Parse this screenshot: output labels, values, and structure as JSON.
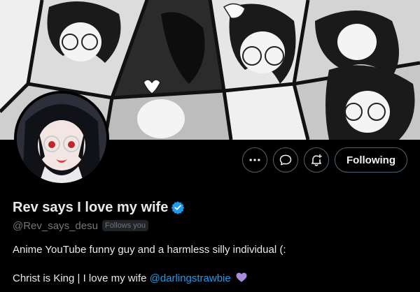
{
  "profile": {
    "display_name": "Rev says I love my wife",
    "handle": "@Rev_says_desu",
    "follows_you": "Follows you",
    "bio_line1": "Anime YouTube funny guy and a harmless silly individual (:",
    "bio_line2_prefix": "Christ is King | I love my wife ",
    "bio_mention": "@darlingstrawbie"
  },
  "actions": {
    "more_icon": "more-horizontal-icon",
    "message_icon": "message-bubble-icon",
    "notify_icon": "bell-plus-icon",
    "following_label": "Following"
  },
  "colors": {
    "background": "#000000",
    "link": "#1d9bf0",
    "verified": "#1d9bf0",
    "heart": "#a98bde",
    "muted": "#71767b"
  }
}
